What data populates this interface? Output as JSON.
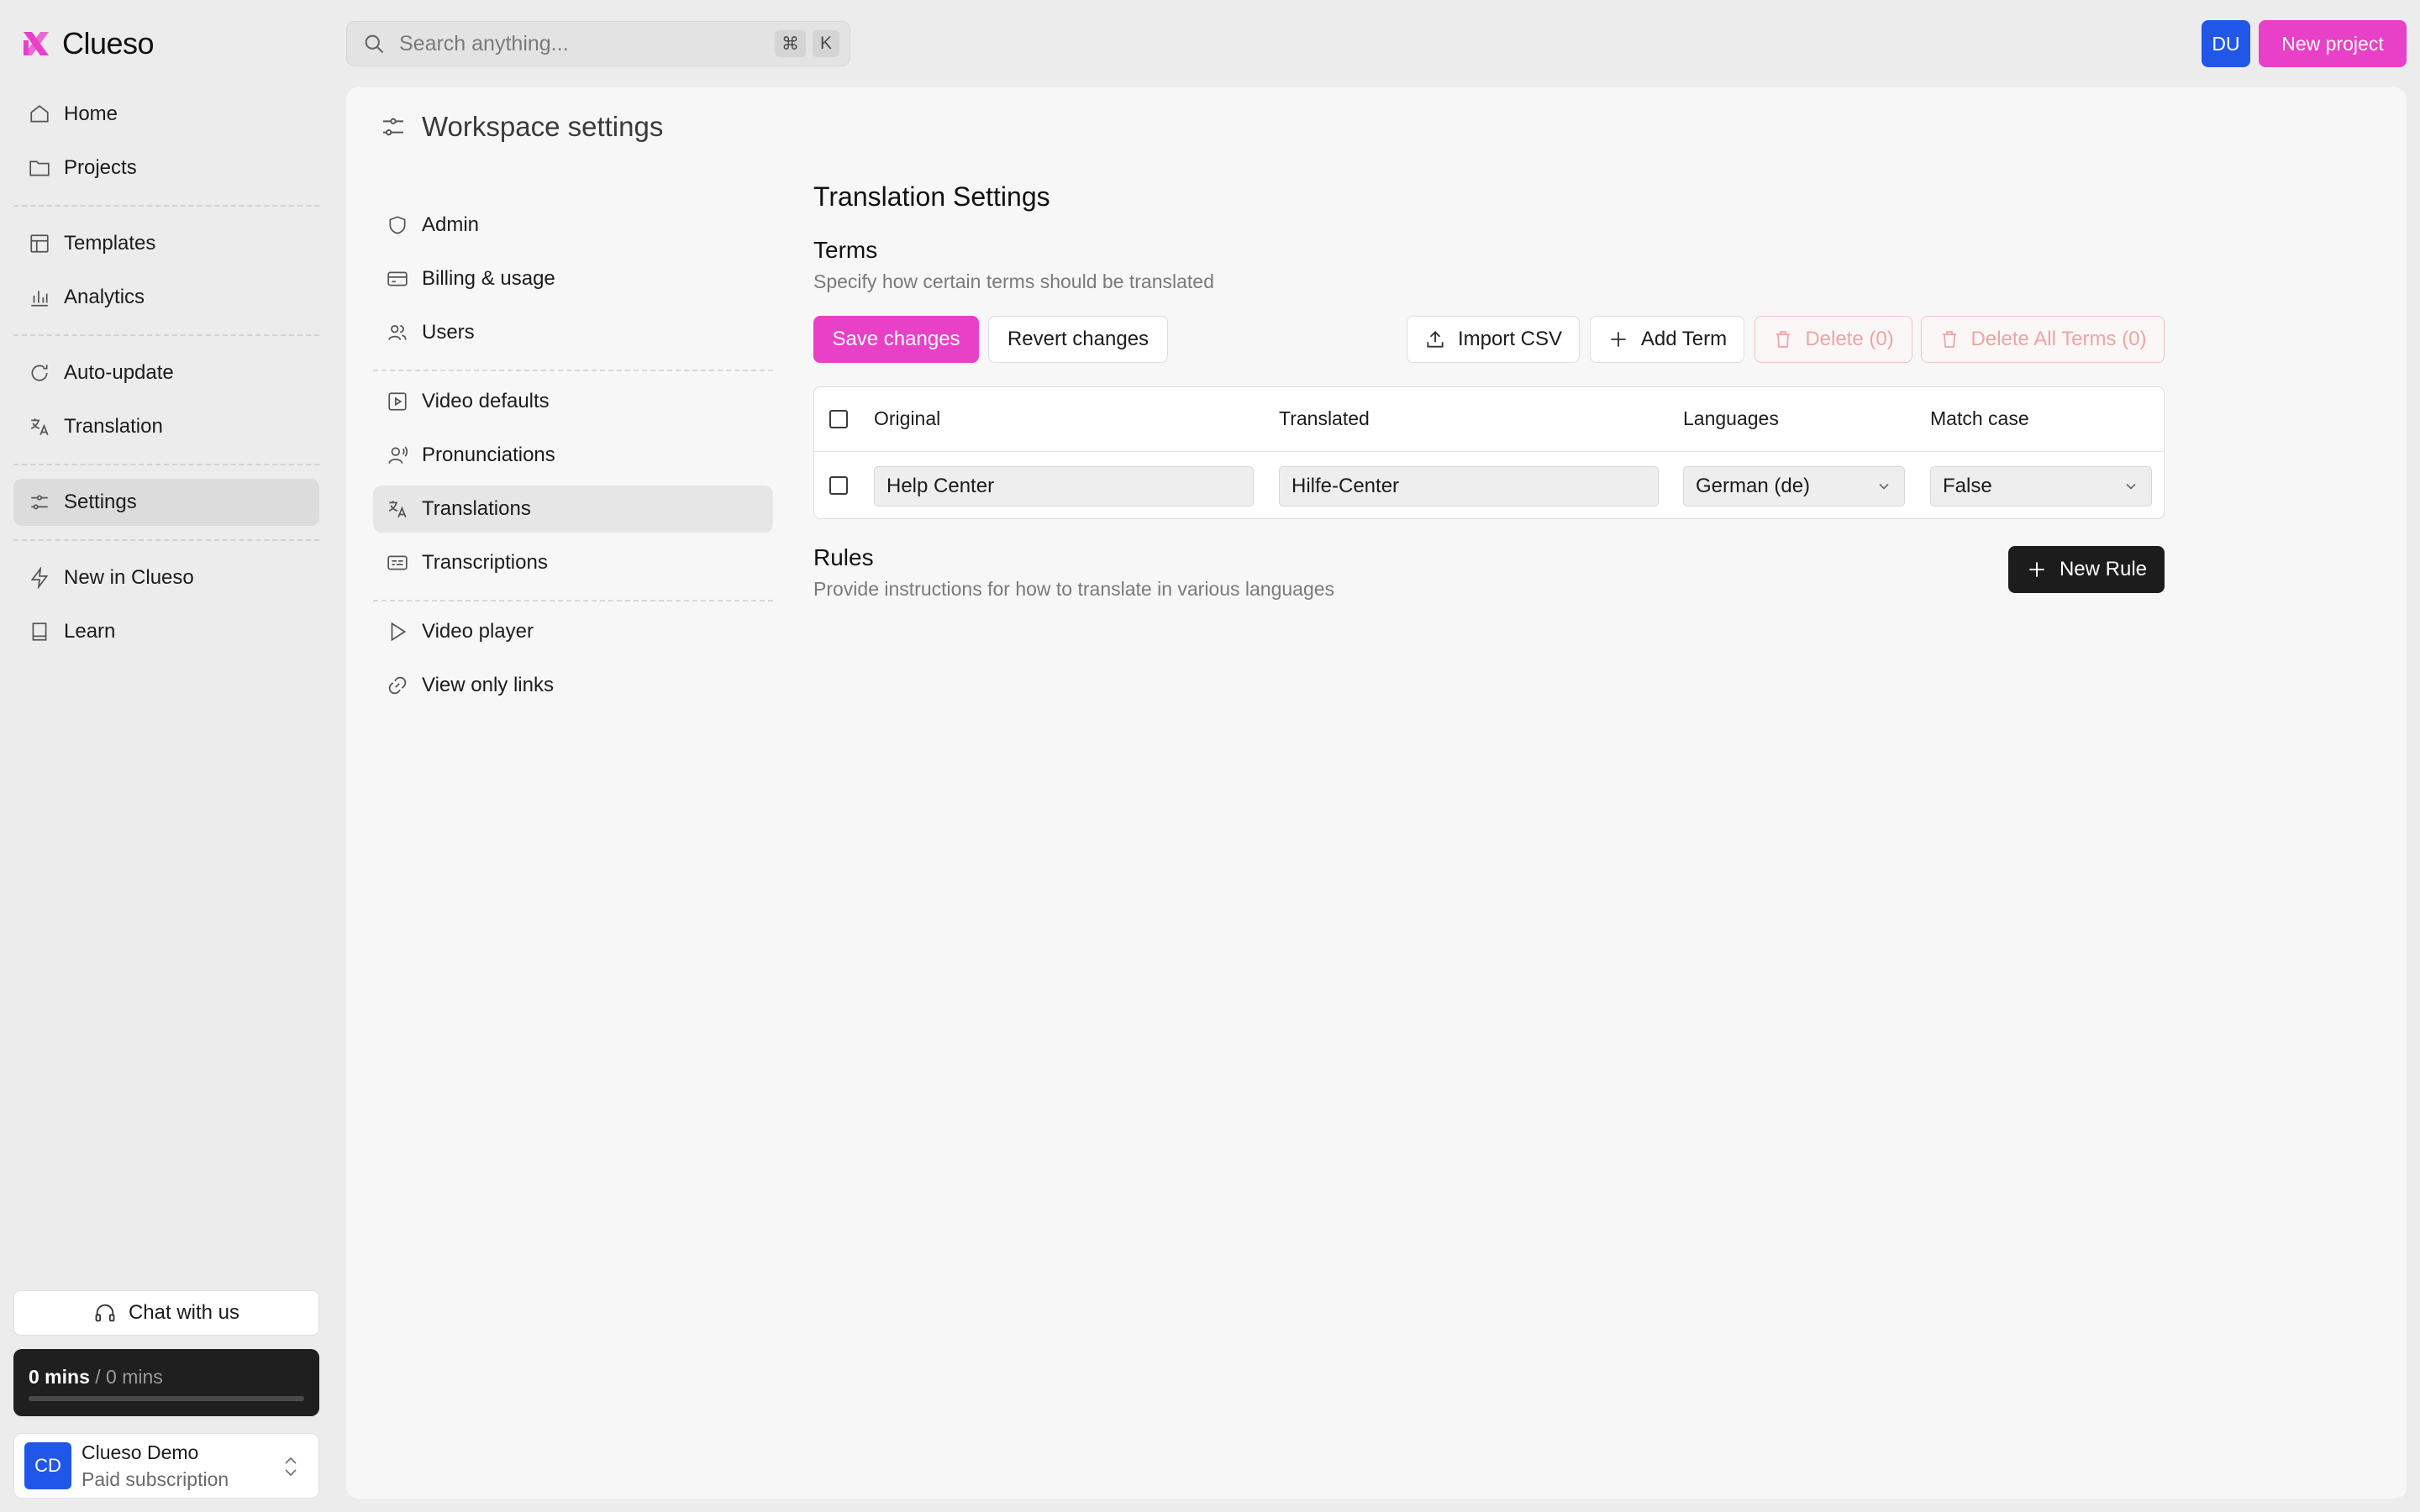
{
  "app": {
    "name": "Clueso"
  },
  "sidebar": {
    "nav": [
      {
        "label": "Home",
        "icon": "home-icon"
      },
      {
        "label": "Projects",
        "icon": "folder-icon"
      },
      {
        "label": "Templates",
        "icon": "layout-icon"
      },
      {
        "label": "Analytics",
        "icon": "bar-chart-icon"
      },
      {
        "label": "Auto-update",
        "icon": "refresh-icon"
      },
      {
        "label": "Translation",
        "icon": "languages-icon"
      },
      {
        "label": "Settings",
        "icon": "sliders-icon",
        "active": true
      },
      {
        "label": "New in Clueso",
        "icon": "lightning-icon"
      },
      {
        "label": "Learn",
        "icon": "book-icon"
      }
    ],
    "chat_label": "Chat with us",
    "usage": {
      "used": "0 mins",
      "separator": " / ",
      "total": "0 mins",
      "progress": 0
    },
    "account": {
      "initials": "CD",
      "name": "Clueso Demo",
      "plan": "Paid subscription"
    }
  },
  "topbar": {
    "search_placeholder": "Search anything...",
    "shortcut": [
      "⌘",
      "K"
    ],
    "user_initials": "DU",
    "new_project_label": "New project"
  },
  "workspace": {
    "title": "Workspace settings",
    "menu": [
      {
        "label": "Admin",
        "icon": "shield-icon"
      },
      {
        "label": "Billing & usage",
        "icon": "credit-card-icon"
      },
      {
        "label": "Users",
        "icon": "users-icon"
      },
      {
        "label": "Video defaults",
        "icon": "video-file-icon"
      },
      {
        "label": "Pronunciations",
        "icon": "user-voice-icon"
      },
      {
        "label": "Translations",
        "icon": "languages-icon",
        "active": true
      },
      {
        "label": "Transcriptions",
        "icon": "captions-icon"
      },
      {
        "label": "Video player",
        "icon": "play-icon"
      },
      {
        "label": "View only links",
        "icon": "link-icon"
      }
    ]
  },
  "translation": {
    "title": "Translation Settings",
    "terms": {
      "title": "Terms",
      "description": "Specify how certain terms should be translated",
      "buttons": {
        "save": "Save changes",
        "revert": "Revert changes",
        "import": "Import CSV",
        "add": "Add Term",
        "delete": "Delete (0)",
        "delete_all": "Delete All Terms (0)"
      },
      "columns": [
        "Original",
        "Translated",
        "Languages",
        "Match case"
      ],
      "rows": [
        {
          "original": "Help Center",
          "translated": "Hilfe-Center",
          "language": "German (de)",
          "match_case": "False"
        }
      ]
    },
    "rules": {
      "title": "Rules",
      "description": "Provide instructions for how to translate in various languages",
      "new_rule_label": "New Rule"
    }
  },
  "colors": {
    "accent": "#e940c8",
    "avatar_blue": "#2157e8",
    "danger_text": "#f0a3a3",
    "dark": "#1c1c1c"
  }
}
